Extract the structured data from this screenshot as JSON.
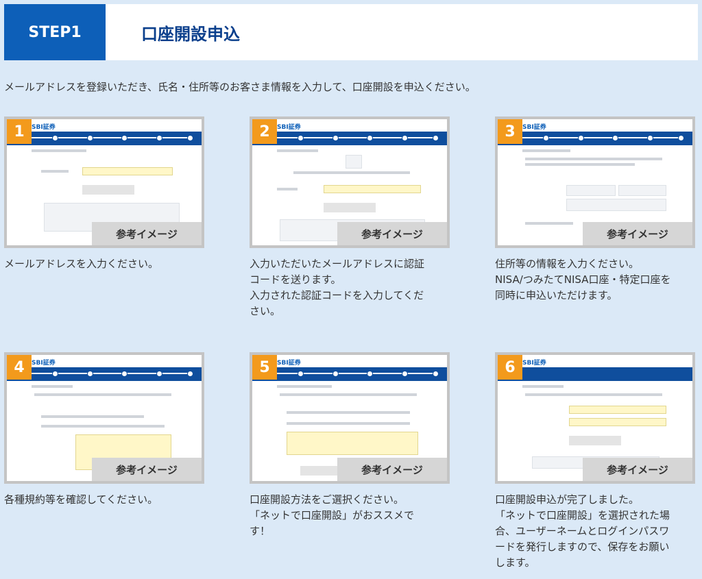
{
  "header": {
    "step": "STEP1",
    "title": "口座開設申込"
  },
  "lead": "メールアドレスを登録いただき、氏名・住所等のお客さま情報を入力して、口座開設を申込ください。",
  "brand": "SBI証券",
  "ref_label": "参考イメージ",
  "steps": [
    {
      "num": "1",
      "desc": "メールアドレスを入力ください。"
    },
    {
      "num": "2",
      "desc": "入力いただいたメールアドレスに認証\nコードを送ります。\n入力された認証コードを入力してくだ\nさい。"
    },
    {
      "num": "3",
      "desc": "住所等の情報を入力ください。\nNISA/つみたてNISA口座・特定口座を\n同時に申込いただけます。"
    },
    {
      "num": "4",
      "desc": "各種規約等を確認してください。"
    },
    {
      "num": "5",
      "desc": "口座開設方法をご選択ください。\n「ネットで口座開設」がおススメで\nす！"
    },
    {
      "num": "6",
      "desc": "口座開設申込が完了しました。\n「ネットで口座開設」を選択された場\n合、ユーザーネームとログインパスワ\nードを発行しますので、保存をお願い\nします。"
    }
  ]
}
